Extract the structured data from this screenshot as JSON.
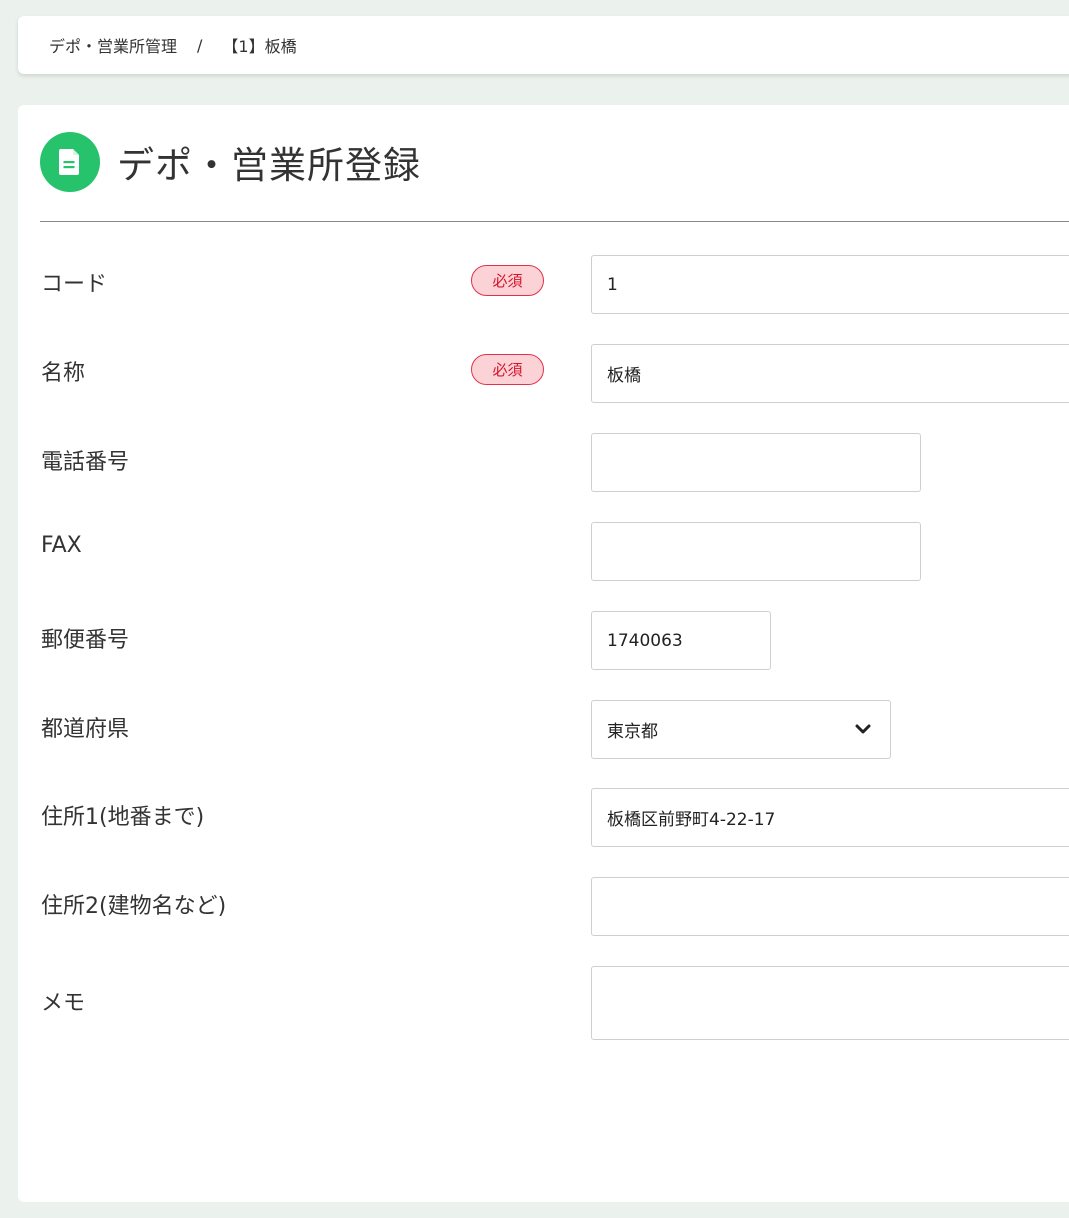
{
  "breadcrumb": {
    "parent": "デポ・営業所管理",
    "separator": "/",
    "current": "【1】板橋"
  },
  "header": {
    "icon": "document-icon",
    "title": "デポ・営業所登録"
  },
  "colors": {
    "accent": "#27c26c",
    "required_border": "#e0334a",
    "required_bg": "#fbd3d7",
    "required_text": "#d6142c",
    "page_bg": "#ebf1ec"
  },
  "form": {
    "required_label": "必須",
    "code": {
      "label": "コード",
      "value": "1"
    },
    "name": {
      "label": "名称",
      "value": "板橋"
    },
    "phone": {
      "label": "電話番号",
      "value": ""
    },
    "fax": {
      "label": "FAX",
      "value": ""
    },
    "postal": {
      "label": "郵便番号",
      "value": "1740063"
    },
    "prefecture": {
      "label": "都道府県",
      "value": "東京都"
    },
    "address1": {
      "label": "住所1(地番まで)",
      "value": "板橋区前野町4-22-17"
    },
    "address2": {
      "label": "住所2(建物名など)",
      "value": ""
    },
    "memo": {
      "label": "メモ",
      "value": ""
    }
  }
}
